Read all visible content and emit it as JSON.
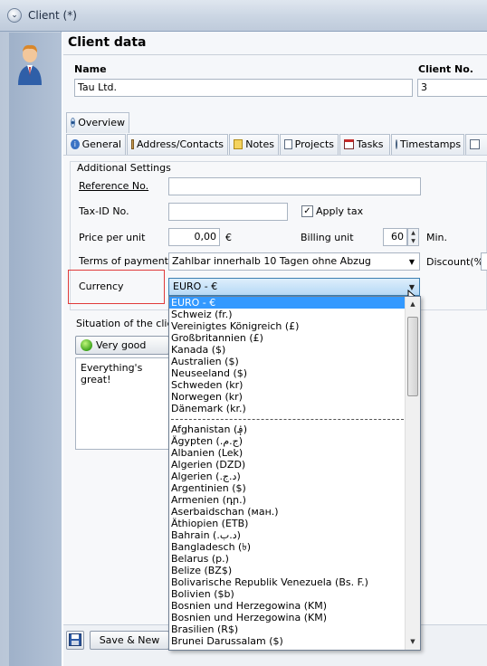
{
  "window": {
    "title": "Client (*)"
  },
  "header": {
    "title": "Client data",
    "name_label": "Name",
    "name_value": "Tau Ltd.",
    "client_no_label": "Client No.",
    "client_no_value": "3"
  },
  "tabs": {
    "overview": "Overview",
    "items": [
      "General",
      "Address/Contacts",
      "Notes",
      "Projects",
      "Tasks",
      "Timestamps"
    ]
  },
  "additional": {
    "group_label": "Additional Settings",
    "reference_label": "Reference No.",
    "reference_value": "",
    "taxid_label": "Tax-ID No.",
    "taxid_value": "",
    "apply_tax_label": "Apply tax",
    "apply_tax_checked": true,
    "price_label": "Price per unit",
    "price_value": "0,00",
    "price_unit": "€",
    "billing_label": "Billing unit",
    "billing_value": "60",
    "billing_unit": "Min.",
    "terms_label": "Terms of payment",
    "terms_value": "Zahlbar innerhalb 10 Tagen ohne Abzug",
    "discount_label": "Discount(%)",
    "currency_label": "Currency",
    "currency_value": "EURO - €"
  },
  "currency_options": [
    "EURO - €",
    "Schweiz (fr.)",
    "Vereinigtes Königreich (£)",
    "Großbritannien (£)",
    "Kanada ($)",
    "Australien ($)",
    "Neuseeland ($)",
    "Schweden (kr)",
    "Norwegen (kr)",
    "Dänemark (kr.)",
    "---",
    "Afghanistan (؋)",
    "Ägypten (ج.م.‏)",
    "Albanien (Lek)",
    "Algerien (DZD)",
    "Algerien (د.ج.‏)",
    "Argentinien ($)",
    "Armenien (դր.)",
    "Aserbaidschan (ман.)",
    "Äthiopien (ETB)",
    "Bahrain (د.ب.‏)",
    "Bangladesch (৳)",
    "Belarus (р.)",
    "Belize (BZ$)",
    "Bolivarische Republik Venezuela (Bs. F.)",
    "Bolivien ($b)",
    "Bosnien und Herzegowina (KM)",
    "Bosnien und Herzegowina (KM)",
    "Brasilien (R$)",
    "Brunei Darussalam ($)"
  ],
  "situation": {
    "label": "Situation of the client",
    "rating": "Very good",
    "notes": "Everything's great!"
  },
  "footer": {
    "save_new_label": "Save & New"
  },
  "colors": {
    "selected": "#3399ff",
    "highlight_box": "#e03a3a"
  }
}
